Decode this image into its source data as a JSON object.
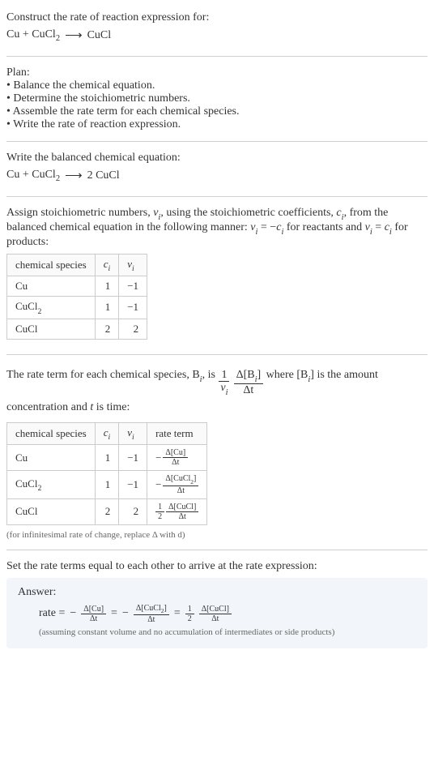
{
  "chart_data": [
    {
      "type": "table",
      "title": "Stoichiometric numbers",
      "columns": [
        "chemical species",
        "c_i",
        "ν_i"
      ],
      "rows": [
        {
          "species": "Cu",
          "c": 1,
          "nu": -1
        },
        {
          "species": "CuCl2",
          "c": 1,
          "nu": -1
        },
        {
          "species": "CuCl",
          "c": 2,
          "nu": 2
        }
      ]
    },
    {
      "type": "table",
      "title": "Rate terms",
      "columns": [
        "chemical species",
        "c_i",
        "ν_i",
        "rate term"
      ],
      "rows": [
        {
          "species": "Cu",
          "c": 1,
          "nu": -1,
          "rate": "-Δ[Cu]/Δt"
        },
        {
          "species": "CuCl2",
          "c": 1,
          "nu": -1,
          "rate": "-Δ[CuCl2]/Δt"
        },
        {
          "species": "CuCl",
          "c": 2,
          "nu": 2,
          "rate": "(1/2) Δ[CuCl]/Δt"
        }
      ]
    }
  ],
  "intro": {
    "line1": "Construct the rate of reaction expression for:",
    "eq_lhs_a": "Cu + CuCl",
    "eq_lhs_sub": "2",
    "arrow": "⟶",
    "eq_rhs": "CuCl"
  },
  "plan": {
    "heading": "Plan:",
    "b1": "• Balance the chemical equation.",
    "b2": "• Determine the stoichiometric numbers.",
    "b3": "• Assemble the rate term for each chemical species.",
    "b4": "• Write the rate of reaction expression."
  },
  "balanced": {
    "line1": "Write the balanced chemical equation:",
    "lhs_a": "Cu + CuCl",
    "lhs_sub": "2",
    "arrow": "⟶",
    "rhs": "2 CuCl"
  },
  "stoich_text": {
    "part1": "Assign stoichiometric numbers, ",
    "nu_i": "ν",
    "i": "i",
    "part2": ", using the stoichiometric coefficients, ",
    "c_i": "c",
    "part3": ", from the balanced chemical equation in the following manner: ",
    "eq1_lhs": "ν",
    "eq1_eq": " = −",
    "eq1_rhs": "c",
    "part4": " for reactants and ",
    "eq2_lhs": "ν",
    "eq2_eq": " = ",
    "eq2_rhs": "c",
    "part5": " for products:"
  },
  "table1": {
    "h1": "chemical species",
    "h2": "c",
    "h2sub": "i",
    "h3": "ν",
    "h3sub": "i",
    "r1c1": "Cu",
    "r1c2": "1",
    "r1c3": "−1",
    "r2c1": "CuCl",
    "r2c1sub": "2",
    "r2c2": "1",
    "r2c3": "−1",
    "r3c1": "CuCl",
    "r3c2": "2",
    "r3c3": "2"
  },
  "rate_text": {
    "part1": "The rate term for each chemical species, B",
    "sub_i": "i",
    "part2": ", is ",
    "frac1_num": "1",
    "frac1_den_a": "ν",
    "frac2_num_a": "Δ[B",
    "frac2_num_b": "]",
    "frac2_den": "Δt",
    "part3": " where [B",
    "part4": "] is the amount concentration and ",
    "t": "t",
    "part5": " is time:"
  },
  "table2": {
    "h1": "chemical species",
    "h2": "c",
    "h2sub": "i",
    "h3": "ν",
    "h3sub": "i",
    "h4": "rate term",
    "r1c1": "Cu",
    "r1c2": "1",
    "r1c3": "−1",
    "r1_rate_sign": "−",
    "r1_rate_num": "Δ[Cu]",
    "r1_rate_den": "Δt",
    "r2c1": "CuCl",
    "r2c1sub": "2",
    "r2c2": "1",
    "r2c3": "−1",
    "r2_rate_sign": "−",
    "r2_rate_num_a": "Δ[CuCl",
    "r2_rate_num_sub": "2",
    "r2_rate_num_b": "]",
    "r2_rate_den": "Δt",
    "r3c1": "CuCl",
    "r3c2": "2",
    "r3c3": "2",
    "r3_half_num": "1",
    "r3_half_den": "2",
    "r3_rate_num": "Δ[CuCl]",
    "r3_rate_den": "Δt"
  },
  "infinitesimal_note": "(for infinitesimal rate of change, replace Δ with d)",
  "final_text": "Set the rate terms equal to each other to arrive at the rate expression:",
  "answer": {
    "label": "Answer:",
    "rate_word": "rate = ",
    "neg": "−",
    "t1_num": "Δ[Cu]",
    "t1_den": "Δt",
    "eq": " = ",
    "t2_num_a": "Δ[CuCl",
    "t2_num_sub": "2",
    "t2_num_b": "]",
    "t2_den": "Δt",
    "half_num": "1",
    "half_den": "2",
    "t3_num": "Δ[CuCl]",
    "t3_den": "Δt",
    "note": "(assuming constant volume and no accumulation of intermediates or side products)"
  }
}
